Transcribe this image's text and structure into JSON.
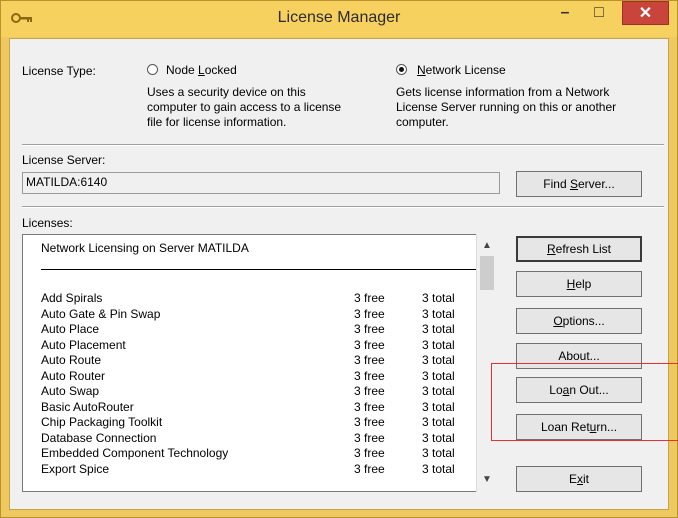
{
  "window": {
    "title": "License Manager",
    "icon": "key-icon",
    "controls": {
      "minimize": "–",
      "maximize": "□",
      "close": "✕"
    },
    "colors": {
      "titlebar": "#f6d15f",
      "close": "#c9443b",
      "highlight": "#e83030"
    }
  },
  "license_type": {
    "label": "License Type:",
    "node_locked": {
      "label_pre": "Node ",
      "label_u": "L",
      "label_post": "ocked",
      "selected": false,
      "desc": [
        "Uses a security device on this",
        "computer to gain access to a license",
        "file for license information."
      ]
    },
    "network": {
      "label_pre": "",
      "label_u": "N",
      "label_post": "etwork License",
      "selected": true,
      "desc": [
        "Gets license information from a Network",
        "License Server running on this or another",
        "computer."
      ]
    }
  },
  "license_server": {
    "label": "License Server:",
    "value": "MATILDA:6140",
    "find_button": {
      "pre": "Find ",
      "u": "S",
      "post": "erver..."
    }
  },
  "licenses": {
    "label": "Licenses:",
    "header": "Network Licensing on Server MATILDA",
    "rows": [
      {
        "name": "Add Spirals",
        "free": "3 free",
        "total": "3 total"
      },
      {
        "name": "Auto Gate & Pin Swap",
        "free": "3 free",
        "total": "3 total"
      },
      {
        "name": "Auto Place",
        "free": "3 free",
        "total": "3 total"
      },
      {
        "name": "Auto Placement",
        "free": "3 free",
        "total": "3 total"
      },
      {
        "name": "Auto Route",
        "free": "3 free",
        "total": "3 total"
      },
      {
        "name": "Auto Router",
        "free": "3 free",
        "total": "3 total"
      },
      {
        "name": "Auto Swap",
        "free": "3 free",
        "total": "3 total"
      },
      {
        "name": "Basic AutoRouter",
        "free": "3 free",
        "total": "3 total"
      },
      {
        "name": "Chip Packaging Toolkit",
        "free": "3 free",
        "total": "3 total"
      },
      {
        "name": "Database Connection",
        "free": "3 free",
        "total": "3 total"
      },
      {
        "name": "Embedded Component Technology",
        "free": "3 free",
        "total": "3 total"
      },
      {
        "name": "Export Spice",
        "free": "3 free",
        "total": "3 total"
      }
    ]
  },
  "buttons": {
    "refresh": {
      "pre": "",
      "u": "R",
      "post": "efresh List"
    },
    "help": {
      "pre": "",
      "u": "H",
      "post": "elp"
    },
    "options": {
      "pre": "",
      "u": "O",
      "post": "ptions..."
    },
    "about": {
      "pre": "About...",
      "u": "",
      "post": ""
    },
    "loan_out": {
      "pre": "Lo",
      "u": "a",
      "post": "n Out..."
    },
    "loan_return": {
      "pre": "Loan Ret",
      "u": "u",
      "post": "rn..."
    },
    "exit": {
      "pre": "E",
      "u": "x",
      "post": "it"
    }
  }
}
